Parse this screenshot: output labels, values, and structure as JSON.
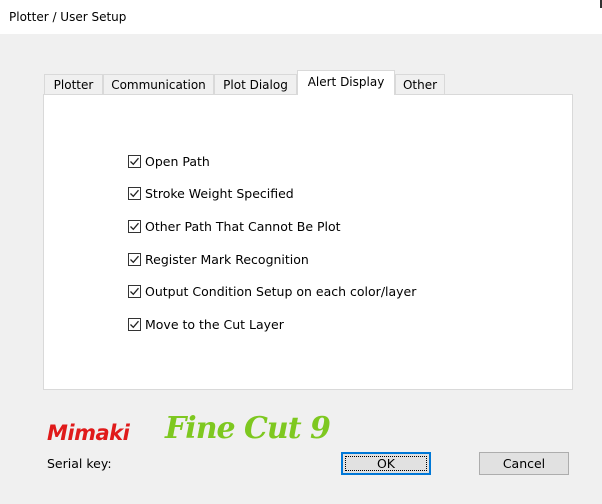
{
  "window": {
    "title": "Plotter / User Setup"
  },
  "tabs": [
    {
      "label": "Plotter",
      "active": false
    },
    {
      "label": "Communication",
      "active": false
    },
    {
      "label": "Plot Dialog",
      "active": false
    },
    {
      "label": "Alert Display",
      "active": true
    },
    {
      "label": "Other",
      "active": false
    }
  ],
  "alerts": [
    {
      "label": "Open Path",
      "checked": true
    },
    {
      "label": "Stroke Weight Specified",
      "checked": true
    },
    {
      "label": "Other Path That Cannot Be Plot",
      "checked": true
    },
    {
      "label": "Register Mark Recognition",
      "checked": true
    },
    {
      "label": "Output Condition Setup on each color/layer",
      "checked": true
    },
    {
      "label": "Move to the Cut Layer",
      "checked": true
    }
  ],
  "logo": {
    "brand": "Mimaki",
    "product": "Fine Cut 9"
  },
  "footer": {
    "serial_label": "Serial key:"
  },
  "buttons": {
    "ok": "OK",
    "cancel": "Cancel"
  },
  "colors": {
    "brand_red": "#e01a1a",
    "product_green": "#7ec820",
    "focus_blue": "#0078d7"
  }
}
